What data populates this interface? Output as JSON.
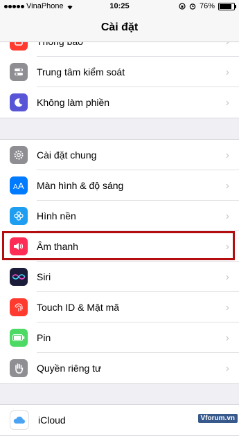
{
  "status_bar": {
    "carrier": "VinaPhone",
    "time": "10:25",
    "battery": "76%"
  },
  "nav": {
    "title": "Cài đặt"
  },
  "group1": [
    {
      "label": "Thông báo",
      "icon": "notification-icon",
      "color": "#ff3b30"
    },
    {
      "label": "Trung tâm kiểm soát",
      "icon": "control-center-icon",
      "color": "#8e8e93"
    },
    {
      "label": "Không làm phiền",
      "icon": "moon-icon",
      "color": "#5856d6"
    }
  ],
  "group2": [
    {
      "label": "Cài đặt chung",
      "icon": "gear-icon",
      "color": "#8e8e93"
    },
    {
      "label": "Màn hình & độ sáng",
      "icon": "display-brightness-icon",
      "color": "#007aff"
    },
    {
      "label": "Hình nền",
      "icon": "wallpaper-icon",
      "color": "#1e9ef0"
    },
    {
      "label": "Âm thanh",
      "icon": "sound-icon",
      "color": "#ff2d55"
    },
    {
      "label": "Siri",
      "icon": "siri-icon",
      "color": "#1b1b3a"
    },
    {
      "label": "Touch ID & Mật mã",
      "icon": "fingerprint-icon",
      "color": "#ff3b30"
    },
    {
      "label": "Pin",
      "icon": "battery-icon",
      "color": "#4cd964"
    },
    {
      "label": "Quyền riêng tư",
      "icon": "hand-icon",
      "color": "#8e8e93"
    }
  ],
  "group3": [
    {
      "label": "iCloud",
      "icon": "icloud-icon",
      "color": "#d8eafd"
    }
  ],
  "watermark": "Vforum.vn"
}
